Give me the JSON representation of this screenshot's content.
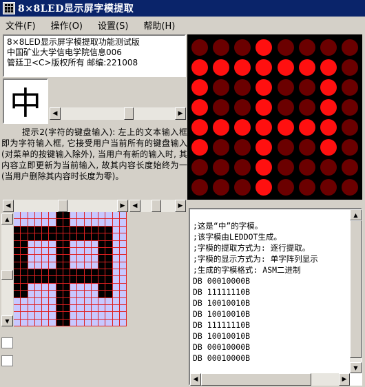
{
  "window": {
    "title": "8×8LED显示屏字模提取"
  },
  "menu": [
    {
      "label": "文件(F)"
    },
    {
      "label": "操作(O)"
    },
    {
      "label": "设置(S)"
    },
    {
      "label": "帮助(H)"
    }
  ],
  "info_lines": [
    "8×8LED显示屏字模提取功能测试版",
    "中国矿业大学信电学院信息006",
    "管廷卫<C>版权所有 邮编:221008"
  ],
  "preview_char": "中",
  "hint_text": "提示2(字符的键盘输入): 左上的文本输入框即为字符输入框, 它接受用户当前所有的键盘输入(对菜单的按键输入除外), 当用户有新的输入时, 其内容立即更新为当前输入, 故其内容长度始终为一(当用户删除其内容时长度为零)。",
  "led_rows": [
    "00010000",
    "11111110",
    "10010010",
    "10010010",
    "11111110",
    "10010010",
    "00010000",
    "00010000"
  ],
  "led_colors": {
    "on": "#ff1010",
    "off": "#6b0000",
    "background": "#000000"
  },
  "grid_colors": {
    "background": "#c8c8ff",
    "line": "#e02020",
    "fill": "#000000"
  },
  "output_lines": [
    ";这是“中”的字模。",
    ";该字模由LEDDOT生成。",
    ";字模的提取方式为: 逐行提取。",
    ";字模的显示方式为: 单字阵列显示",
    ";生成的字模格式: ASM二进制",
    "DB 00010000B",
    "DB 11111110B",
    "DB 10010010B",
    "DB 10010010B",
    "DB 11111110B",
    "DB 10010010B",
    "DB 00010000B",
    "DB 00010000B"
  ]
}
